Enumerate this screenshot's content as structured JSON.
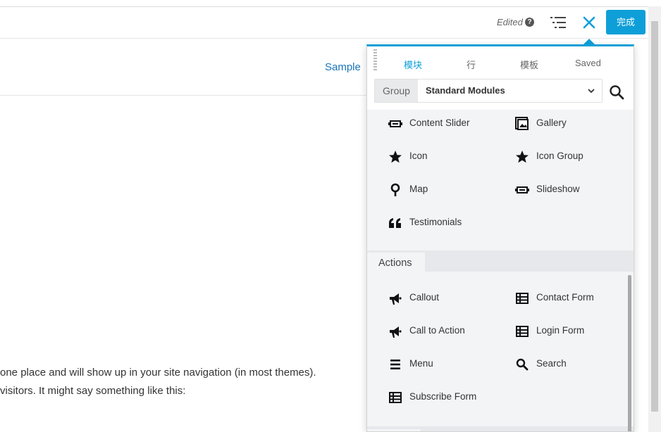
{
  "topbar": {
    "edited_label": "Edited",
    "help_icon": "question-circle-icon",
    "outline_icon": "outline-list-icon",
    "close_icon": "close-icon",
    "done_label": "完成",
    "accent_color": "#0e9fd8"
  },
  "page": {
    "nav_link": "Sample",
    "body_lines": [
      "one place and will show up in your site navigation (in most themes).",
      "visitors. It might say something like this:"
    ]
  },
  "panel": {
    "tabs": [
      {
        "label": "模块",
        "active": true
      },
      {
        "label": "行",
        "active": false
      },
      {
        "label": "模板",
        "active": false
      },
      {
        "label": "Saved",
        "active": false
      }
    ],
    "group_label": "Group",
    "group_value": "Standard Modules",
    "modules": [
      {
        "label": "Content Slider",
        "icon": "slider-icon"
      },
      {
        "label": "Gallery",
        "icon": "gallery-icon"
      },
      {
        "label": "Icon",
        "icon": "star-icon"
      },
      {
        "label": "Icon Group",
        "icon": "star-icon"
      },
      {
        "label": "Map",
        "icon": "map-pin-icon"
      },
      {
        "label": "Slideshow",
        "icon": "slider-icon"
      },
      {
        "label": "Testimonials",
        "icon": "quote-icon"
      }
    ],
    "actions_title": "Actions",
    "actions": [
      {
        "label": "Callout",
        "icon": "megaphone-icon"
      },
      {
        "label": "Contact Form",
        "icon": "form-table-icon"
      },
      {
        "label": "Call to Action",
        "icon": "megaphone-icon"
      },
      {
        "label": "Login Form",
        "icon": "form-table-icon"
      },
      {
        "label": "Menu",
        "icon": "menu-icon"
      },
      {
        "label": "Search",
        "icon": "search-icon"
      },
      {
        "label": "Subscribe Form",
        "icon": "form-table-icon"
      }
    ]
  }
}
